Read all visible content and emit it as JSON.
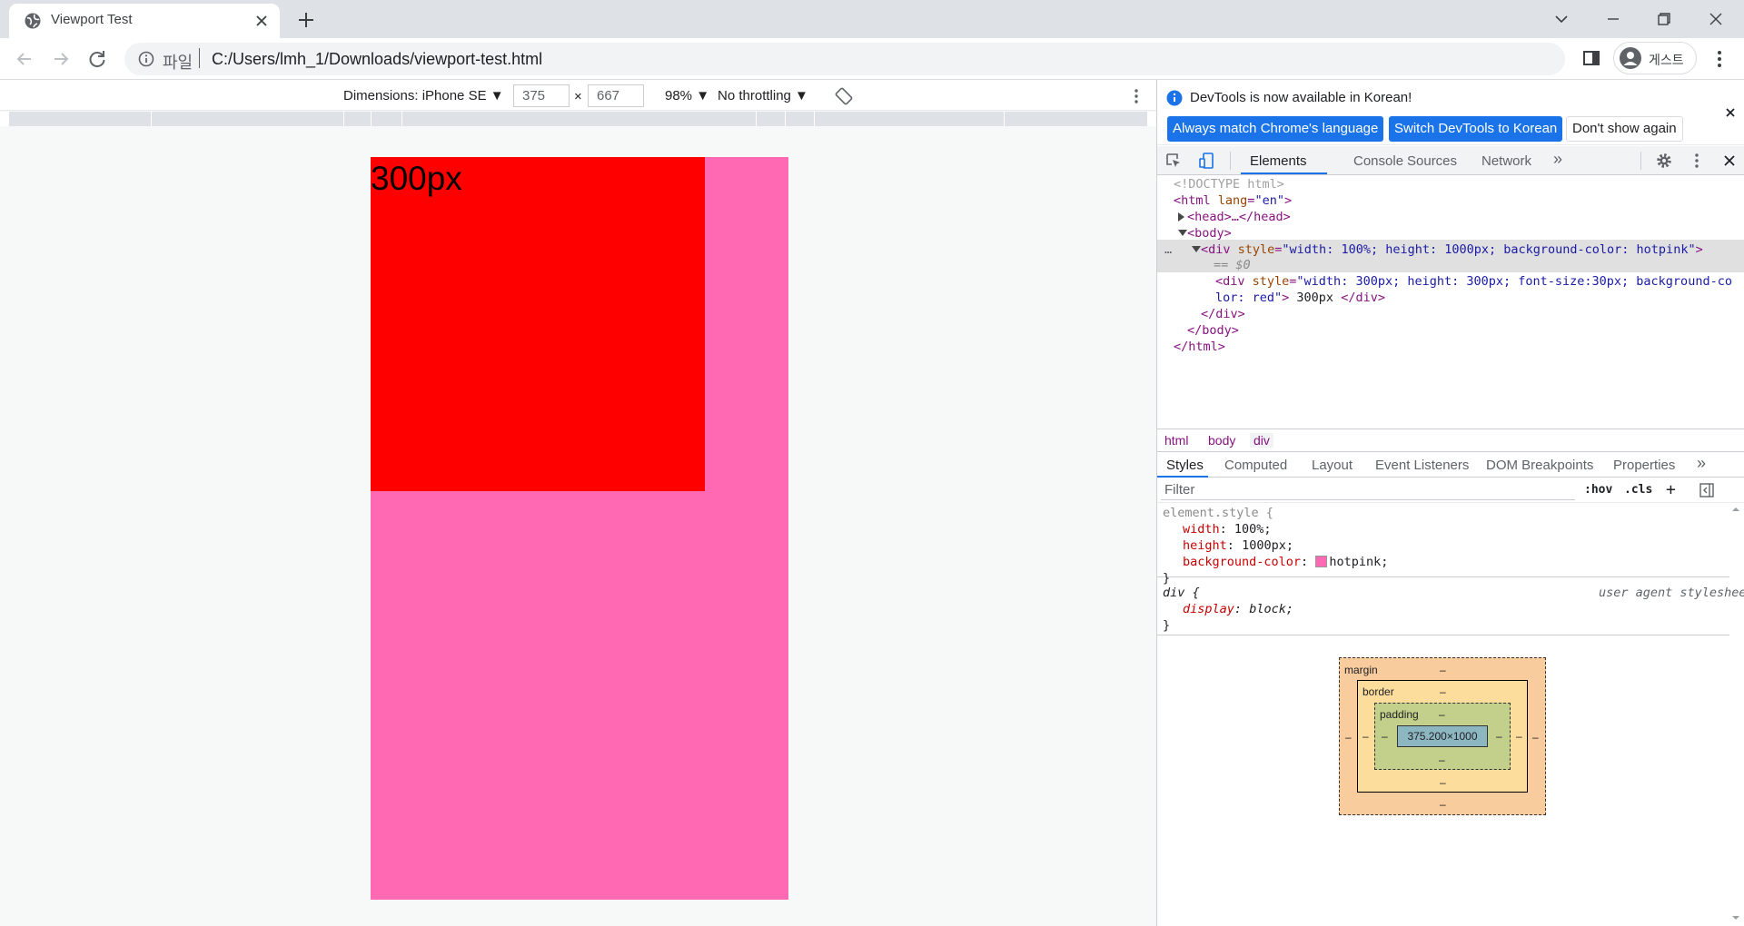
{
  "tab": {
    "title": "Viewport Test"
  },
  "omnibox": {
    "scheme_label": "파일",
    "url": "C:/Users/lmh_1/Downloads/viewport-test.html"
  },
  "profile": {
    "label": "게스트"
  },
  "device_toolbar": {
    "dimensions_label": "Dimensions: iPhone SE ▼",
    "width": "375",
    "height": "667",
    "times": "×",
    "zoom": "98% ▼",
    "throttling": "No throttling ▼"
  },
  "page": {
    "red_box_text": "300px",
    "outer_background": "#ff69b4",
    "inner_background": "#ff0000"
  },
  "devtools": {
    "infobar": {
      "message": "DevTools is now available in Korean!",
      "btn_always_match": "Always match Chrome's language",
      "btn_switch": "Switch DevTools to Korean",
      "btn_dont_show": "Don't show again"
    },
    "tabs": [
      "Elements",
      "Console",
      "Sources",
      "Network"
    ],
    "more_tabs": "»",
    "elements": {
      "doctype": "<!DOCTYPE html>",
      "html_open_tag": "<html ",
      "html_attr": "lang",
      "html_attr_value": "\"en\"",
      "tag_close": ">",
      "head_collapsed": "<head>…</head>",
      "body_open": "<body>",
      "div_open_tag": "<div ",
      "style_attr": "style",
      "outer_div_style": "\"width: 100%; height: 1000px; background-color: hotpink\"",
      "dollar_zero": "== $0",
      "inner_div_style_line1": "\"width: 300px; height: 300px; font-size:30px; background-co",
      "inner_div_style_line2": "lor: red\"",
      "inner_div_text": " 300px ",
      "div_close": "</div>",
      "body_close": "</body>",
      "html_close": "</html>",
      "ellipsis": "…",
      "equals": "="
    },
    "breadcrumbs": [
      "html",
      "body",
      "div"
    ],
    "sub_tabs": [
      "Styles",
      "Computed",
      "Layout",
      "Event Listeners",
      "DOM Breakpoints",
      "Properties"
    ],
    "sub_more": "»",
    "filter_placeholder": "Filter",
    "hov_label": ":hov",
    "cls_label": ".cls",
    "plus_label": "+",
    "styles": {
      "element_style_selector": "element.style {",
      "props": [
        {
          "name": "width",
          "value": "100%;"
        },
        {
          "name": "height",
          "value": "1000px;"
        },
        {
          "name": "background-color",
          "value": "hotpink;",
          "swatch": "#ff69b4"
        }
      ],
      "close_brace": "}",
      "div_selector": "div {",
      "ua_source": "user agent stylesheet",
      "ua_prop_name": "display",
      "ua_prop_value": "block;",
      "colon": ":"
    },
    "box_model": {
      "margin_label": "margin",
      "border_label": "border",
      "padding_label": "padding",
      "dash": "–",
      "content_size": "375.200×1000"
    }
  }
}
